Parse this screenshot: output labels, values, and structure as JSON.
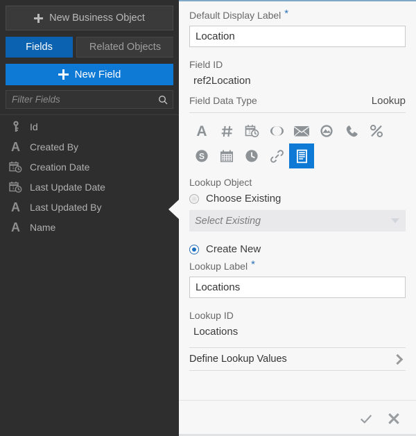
{
  "sidebar": {
    "new_business_object": {
      "label": "New Business Object",
      "icon": "plus-icon"
    },
    "tabs": [
      {
        "label": "Fields",
        "active": true
      },
      {
        "label": "Related Objects",
        "active": false
      }
    ],
    "new_field": {
      "label": "New Field",
      "icon": "plus-icon"
    },
    "filter": {
      "placeholder": "Filter Fields",
      "value": "",
      "icon": "search-icon"
    },
    "fields": [
      {
        "label": "Id",
        "icon": "key-icon"
      },
      {
        "label": "Created By",
        "icon": "text-icon"
      },
      {
        "label": "Creation Date",
        "icon": "datetime-icon"
      },
      {
        "label": "Last Update Date",
        "icon": "datetime-icon"
      },
      {
        "label": "Last Updated By",
        "icon": "text-icon"
      },
      {
        "label": "Name",
        "icon": "text-icon"
      }
    ]
  },
  "panel": {
    "default_display_label": {
      "label": "Default Display Label",
      "required_marker": "*",
      "value": "Location"
    },
    "field_id": {
      "label": "Field ID",
      "value": "ref2Location"
    },
    "field_data_type": {
      "label": "Field Data Type",
      "value": "Lookup"
    },
    "data_type_icons": [
      {
        "name": "text-icon",
        "selected": false
      },
      {
        "name": "number-icon",
        "selected": false
      },
      {
        "name": "datetime-icon",
        "selected": false
      },
      {
        "name": "boolean-icon",
        "selected": false
      },
      {
        "name": "email-icon",
        "selected": false
      },
      {
        "name": "image-icon",
        "selected": false
      },
      {
        "name": "phone-icon",
        "selected": false
      },
      {
        "name": "percent-icon",
        "selected": false
      },
      {
        "name": "currency-icon",
        "selected": false
      },
      {
        "name": "date-icon",
        "selected": false
      },
      {
        "name": "time-icon",
        "selected": false
      },
      {
        "name": "url-icon",
        "selected": false
      },
      {
        "name": "lookup-icon",
        "selected": true
      }
    ],
    "lookup_object": {
      "label": "Lookup Object",
      "choose_existing": {
        "label": "Choose Existing",
        "selected": false
      },
      "select_existing": {
        "placeholder": "Select Existing",
        "value": "",
        "icon": "chevron-down-icon"
      },
      "create_new": {
        "label": "Create New",
        "selected": true
      }
    },
    "lookup_label": {
      "label": "Lookup Label",
      "required_marker": "*",
      "value": "Locations"
    },
    "lookup_id": {
      "label": "Lookup ID",
      "value": "Locations"
    },
    "define_lookup_values": {
      "label": "Define Lookup Values",
      "icon": "chevron-right-icon"
    },
    "footer": {
      "confirm": {
        "icon": "check-icon"
      },
      "cancel": {
        "icon": "close-icon"
      }
    }
  },
  "colors": {
    "accent_blue": "#0f79d6",
    "tab_blue": "#0a62b0",
    "sidebar_bg": "#2e2e2e",
    "panel_bg": "#f7f7f7",
    "required_star": "#2d72b8"
  }
}
